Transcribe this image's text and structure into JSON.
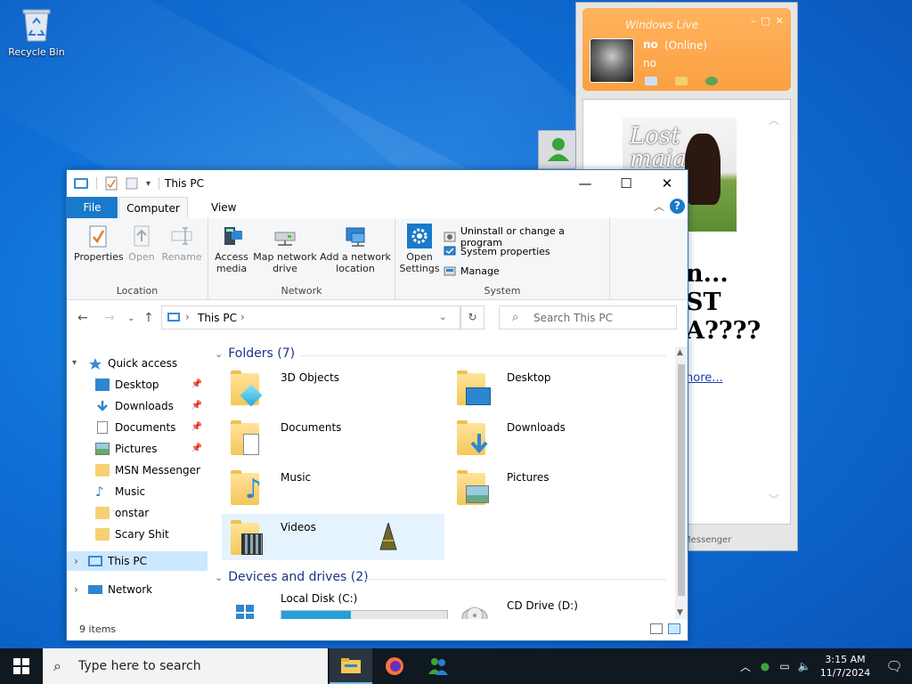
{
  "desktop": {
    "recycle_bin_label": "Recycle Bin"
  },
  "msn": {
    "title": "Windows Live",
    "name": "no",
    "status": "(Online)",
    "personal_message": "no",
    "image_text": "Lost\nmaia\n??",
    "big_text_1": "n...",
    "big_text_2": "ST",
    "big_text_3": "A????",
    "more_link": "nore...",
    "footer": "Messenger"
  },
  "explorer": {
    "title": "This PC",
    "tabs": {
      "file": "File",
      "computer": "Computer",
      "view": "View"
    },
    "ribbon": {
      "location": {
        "label": "Location",
        "properties": "Properties",
        "open": "Open",
        "rename": "Rename"
      },
      "network": {
        "label": "Network",
        "access_media": "Access\nmedia",
        "map_drive": "Map network\ndrive",
        "add_location": "Add a network\nlocation"
      },
      "system": {
        "label": "System",
        "open_settings": "Open\nSettings",
        "uninstall": "Uninstall or change a program",
        "system_properties": "System properties",
        "manage": "Manage"
      }
    },
    "address": {
      "path": "This PC",
      "search_placeholder": "Search This PC"
    },
    "nav": {
      "quick_access": "Quick access",
      "items": [
        "Desktop",
        "Downloads",
        "Documents",
        "Pictures",
        "MSN Messenger",
        "Music",
        "onstar",
        "Scary Shit"
      ],
      "this_pc": "This PC",
      "network": "Network"
    },
    "folders_header": "Folders (7)",
    "folders": [
      "3D Objects",
      "Desktop",
      "Documents",
      "Downloads",
      "Music",
      "Pictures",
      "Videos"
    ],
    "devices_header": "Devices and drives (2)",
    "drives": {
      "c": "Local Disk (C:)",
      "d": "CD Drive (D:)",
      "c_used_fraction": 0.42
    },
    "status": "9 items"
  },
  "taskbar": {
    "search_placeholder": "Type here to search",
    "time": "3:15 AM",
    "date": "11/7/2024"
  },
  "colors": {
    "accent": "#1979ca",
    "selection": "#cce8ff",
    "taskbar": "#101820"
  }
}
